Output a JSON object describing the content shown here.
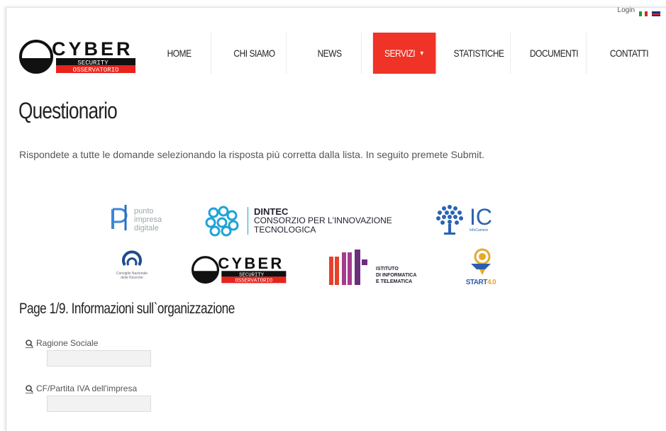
{
  "header": {
    "login_label": "Login",
    "logo": {
      "main": "CYBER",
      "security": "SECURITY",
      "observatory": "OSSERVATORIO"
    }
  },
  "nav": {
    "items": [
      {
        "label": "HOME"
      },
      {
        "label": "CHI SIAMO"
      },
      {
        "label": "NEWS"
      },
      {
        "label": "SERVIZI",
        "active": true,
        "dropdown": true
      },
      {
        "label": "STATISTICHE"
      },
      {
        "label": "DOCUMENTI"
      },
      {
        "label": "CONTATTI"
      }
    ],
    "accent_color": "#ef3326"
  },
  "page": {
    "title": "Questionario",
    "intro": "Rispondete a tutte le domande selezionando la risposta più corretta dalla lista. In seguito premete Submit."
  },
  "partners": {
    "pid": {
      "line1": "punto",
      "line2": "impresa",
      "line3": "digitale"
    },
    "dintec": {
      "name": "DINTEC",
      "line1": "CONSORZIO PER L'INNOVAZIONE",
      "line2": "TECNOLOGICA"
    },
    "ic": {
      "name": "IC",
      "sub": "InfoCamere"
    },
    "cnr": {
      "line1": "Consiglio Nazionale",
      "line2": "delle Ricerche"
    },
    "iit": {
      "line1": "ISTITUTO",
      "line2": "DI INFORMATICA",
      "line3": "E TELEMATICA"
    },
    "start": {
      "label_a": "START",
      "label_b": "4.0"
    }
  },
  "form": {
    "section_title": "Page 1/9. Informazioni sull`organizzazione",
    "fields": [
      {
        "label": "Ragione Sociale",
        "value": ""
      },
      {
        "label": "CF/Partita IVA dell'impresa",
        "value": ""
      }
    ]
  }
}
